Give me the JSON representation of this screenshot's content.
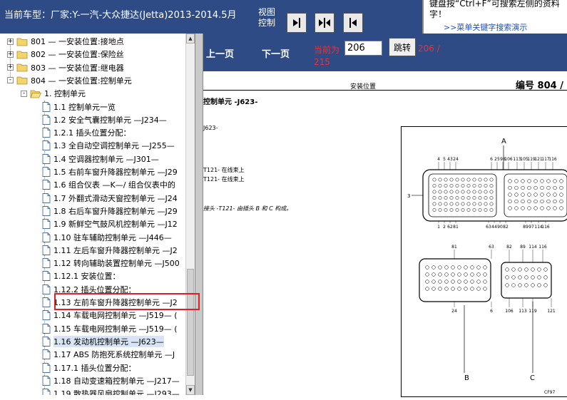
{
  "header": {
    "model_text": "当前车型：厂家:Y-一汽-大众捷达(Jetta)2013-2014.5月",
    "view_label": "视图控制",
    "hint_text_line1": "键盘按“Ctrl+F”可搜索左侧的资料",
    "hint_text_line2": "字！",
    "hint_link": ">>菜单关键字搜索演示"
  },
  "view_buttons": [
    {
      "name": "view-left-panel-button",
      "icon": "arrow-right-bar-icon"
    },
    {
      "name": "view-split-button",
      "icon": "split-arrows-icon"
    },
    {
      "name": "view-right-panel-button",
      "icon": "arrow-left-bar-icon"
    }
  ],
  "tree": {
    "items": [
      {
        "label": "801 — 一安装位置:接地点",
        "type": "folder",
        "expander": "+"
      },
      {
        "label": "802 — 一安装位置:保险丝",
        "type": "folder",
        "expander": "+"
      },
      {
        "label": "803 — 一安装位置:继电器",
        "type": "folder",
        "expander": "+"
      },
      {
        "label": "804 — 一安装位置:控制单元",
        "type": "folder",
        "expander": "-"
      },
      {
        "label": "1. 控制单元",
        "type": "folder-open",
        "expander": "-"
      },
      {
        "label": "1.1 控制单元一览",
        "type": "doc"
      },
      {
        "label": "1.2 安全气囊控制单元 —J234—",
        "type": "doc"
      },
      {
        "label": "1.2.1 插头位置分配：",
        "type": "doc"
      },
      {
        "label": "1.3 全自动空调控制单元 —J255—",
        "type": "doc"
      },
      {
        "label": "1.4 空调器控制单元 —J301—",
        "type": "doc"
      },
      {
        "label": "1.5 右前车窗升降器控制单元 —J29",
        "type": "doc"
      },
      {
        "label": "1.6 组合仪表 —K—/ 组合仪表中的",
        "type": "doc"
      },
      {
        "label": "1.7 外翻式滑动天窗控制单元 —J24",
        "type": "doc"
      },
      {
        "label": "1.8 右后车窗升降器控制单元 —J29",
        "type": "doc"
      },
      {
        "label": "1.9 新鲜空气鼓风机控制单元 —J12",
        "type": "doc"
      },
      {
        "label": "1.10 驻车辅助控制单元 —J446—",
        "type": "doc"
      },
      {
        "label": "1.11 左后车窗升降器控制单元 —J2",
        "type": "doc"
      },
      {
        "label": "1.12 转向辅助装置控制单元 —J500",
        "type": "doc"
      },
      {
        "label": "1.12.1 安装位置：",
        "type": "doc"
      },
      {
        "label": "1.12.2 插头位置分配：",
        "type": "doc"
      },
      {
        "label": "1.13 左前车窗升降器控制单元 —J2",
        "type": "doc"
      },
      {
        "label": "1.14 车载电网控制单元 —J519— (",
        "type": "doc"
      },
      {
        "label": "1.15 车载电网控制单元 —J519— (",
        "type": "doc"
      },
      {
        "label": "1.16 发动机控制单元 —J623—",
        "type": "doc",
        "selected": true
      },
      {
        "label": "1.17 ABS 防抱死系统控制单元 —J",
        "type": "doc"
      },
      {
        "label": "1.17.1 插头位置分配：",
        "type": "doc"
      },
      {
        "label": "1.18 自动变速箱控制单元 —J217—",
        "type": "doc"
      },
      {
        "label": "1.19 散热器风扇控制单元 —J293—",
        "type": "doc"
      }
    ]
  },
  "nav": {
    "prev_label": "上一页",
    "next_label": "下一页",
    "current_label": "当前为",
    "page_value": "206",
    "jump_label": "跳转",
    "total_label": "206 /",
    "total_label2": "215"
  },
  "document": {
    "section_title": "安装位置",
    "code_label": "编号  804 /",
    "title": "控制单元 -J623-",
    "line1": "J623-",
    "line2": "T121- 在线束上",
    "line3": "T121- 在线束上",
    "line4": "接头 -T121- 由插头 B 和 C 构成。"
  },
  "diagram": {
    "label_A": "A",
    "label_B": "B",
    "label_C": "C",
    "top_pins": [
      "4",
      "5",
      "43",
      "24",
      "6",
      "25",
      "98",
      "106",
      "113",
      "105",
      "119",
      "121",
      "117",
      "116"
    ],
    "bottom_pins": [
      "1",
      "2",
      "62",
      "81",
      "63",
      "44",
      "90",
      "82",
      "89",
      "97",
      "114",
      "116"
    ],
    "left_pin": "3",
    "b_top_pins": [
      "81",
      "63"
    ],
    "b_bottom_pins": [
      "24",
      "6"
    ],
    "c_top_pins": [
      "82",
      "89",
      "114",
      "116"
    ],
    "c_bottom_pins": [
      "106",
      "113",
      "119",
      "121"
    ],
    "ref_code": "CF97"
  },
  "colors": {
    "header_bg": "#2e4b86",
    "highlight": "#e02020",
    "page_red": "#ff2a2a"
  }
}
